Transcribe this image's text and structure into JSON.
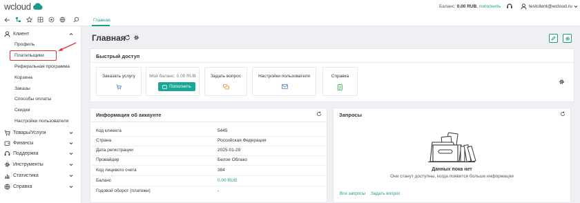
{
  "brand": {
    "logo_text": "wcloud"
  },
  "topbar": {
    "balance_label": "Баланс:",
    "balance_value": "0.00 RUB",
    "topup_link": "пополнить",
    "user_email": "testclient@wcloud.ru"
  },
  "tabs": {
    "home": "Главная"
  },
  "sidebar": {
    "client": {
      "label": "Клиент"
    },
    "client_items": [
      "Профиль",
      "Плательщики",
      "Реферальная программа",
      "Корзина",
      "Заказы",
      "Способы оплаты",
      "Скидки",
      "Настройки пользователя"
    ],
    "groups": [
      {
        "label": "Товары/Услуги",
        "icon": "cart-icon"
      },
      {
        "label": "Финансы",
        "icon": "wallet-icon"
      },
      {
        "label": "Поддержка",
        "icon": "headset-icon"
      },
      {
        "label": "Инструменты",
        "icon": "gear-icon"
      },
      {
        "label": "Статистика",
        "icon": "chart-icon"
      },
      {
        "label": "Справка",
        "icon": "globe-icon"
      }
    ]
  },
  "page": {
    "title": "Главная"
  },
  "quick_access": {
    "title": "Быстрый доступ",
    "cards": [
      {
        "label": "Заказать услугу",
        "icon": "cart-icon"
      },
      {
        "label": "Мой баланс: 0.00 RUB",
        "button": "Пополнить"
      },
      {
        "label": "Задать вопрос",
        "icon": "chat-icon"
      },
      {
        "label": "Настройки пользователя",
        "icon": "mail-icon"
      },
      {
        "label": "Справка",
        "icon": "document-icon"
      }
    ]
  },
  "account_info": {
    "title": "Информация об аккаунте",
    "rows": [
      {
        "key": "Код клиента",
        "value": "5445"
      },
      {
        "key": "Страна",
        "value": "Российская Федерация"
      },
      {
        "key": "Дата регистрации",
        "value": "2025-01-29"
      },
      {
        "key": "Провайдер",
        "value": "Белое Облако"
      },
      {
        "key": "Код лицевого счета",
        "value": "384"
      },
      {
        "key": "Баланс",
        "value": "0.00 RUB"
      },
      {
        "key": "Годовой оборот (платежи)",
        "value": "-"
      }
    ]
  },
  "requests": {
    "title": "Запросы",
    "empty_title": "Данных пока нет",
    "empty_subtitle": "Они станут доступны, когда появится больше информации",
    "all_link": "Все запросы",
    "ask_link": "Задать вопрос"
  },
  "colors": {
    "accent": "#1a9b8a",
    "highlight": "#dd3333"
  }
}
